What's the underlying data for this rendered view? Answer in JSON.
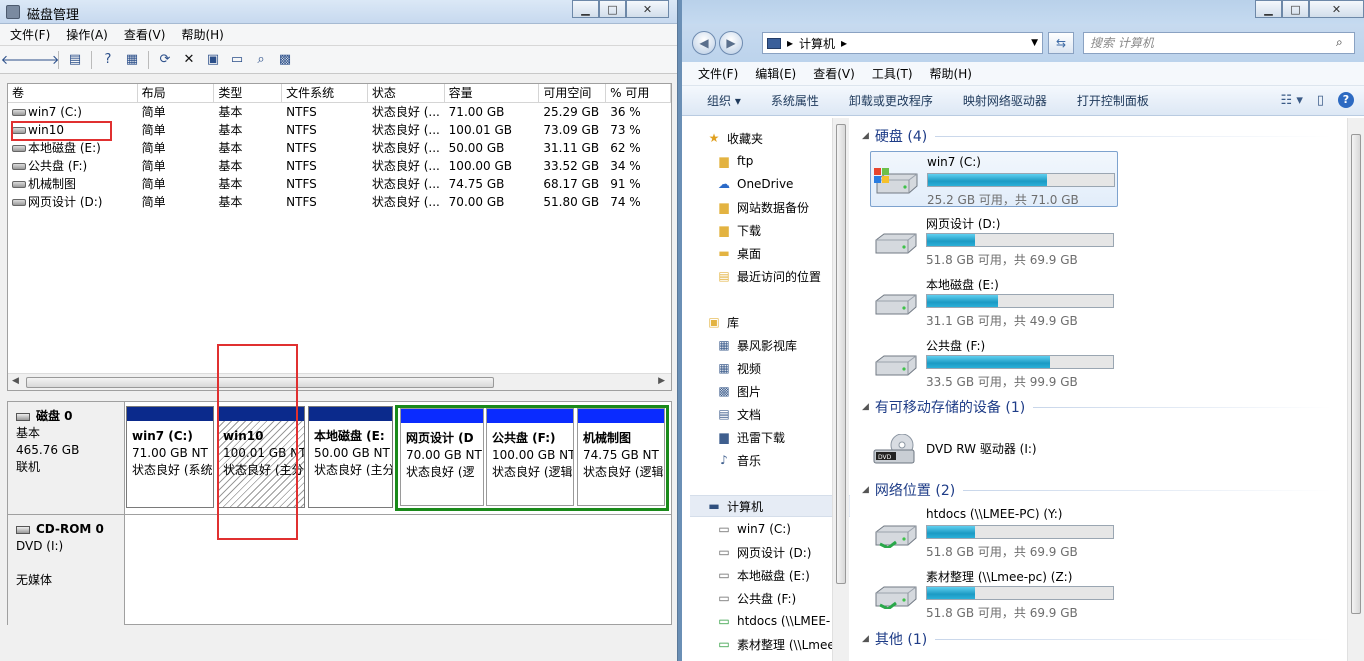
{
  "disk_mgmt": {
    "title": "磁盘管理",
    "menu": [
      "文件(F)",
      "操作(A)",
      "查看(V)",
      "帮助(H)"
    ],
    "columns": [
      "卷",
      "布局",
      "类型",
      "文件系统",
      "状态",
      "容量",
      "可用空间",
      "% 可用"
    ],
    "volumes": [
      [
        "win7 (C:)",
        "简单",
        "基本",
        "NTFS",
        "状态良好 (...",
        "71.00 GB",
        "25.29 GB",
        "36 %"
      ],
      [
        "win10",
        "简单",
        "基本",
        "NTFS",
        "状态良好 (...",
        "100.01 GB",
        "73.09 GB",
        "73 %"
      ],
      [
        "本地磁盘 (E:)",
        "简单",
        "基本",
        "NTFS",
        "状态良好 (...",
        "50.00 GB",
        "31.11 GB",
        "62 %"
      ],
      [
        "公共盘 (F:)",
        "简单",
        "基本",
        "NTFS",
        "状态良好 (...",
        "100.00 GB",
        "33.52 GB",
        "34 %"
      ],
      [
        "机械制图",
        "简单",
        "基本",
        "NTFS",
        "状态良好 (...",
        "74.75 GB",
        "68.17 GB",
        "91 %"
      ],
      [
        "网页设计 (D:)",
        "简单",
        "基本",
        "NTFS",
        "状态良好 (...",
        "70.00 GB",
        "51.80 GB",
        "74 %"
      ]
    ],
    "disk0": {
      "name": "磁盘 0",
      "type": "基本",
      "size": "465.76 GB",
      "status": "联机"
    },
    "partitions": [
      {
        "name": "win7  (C:)",
        "size": "71.00 GB NT",
        "status": "状态良好 (系统"
      },
      {
        "name": "win10",
        "size": "100.01 GB NT",
        "status": "状态良好 (主分"
      },
      {
        "name": "本地磁盘  (E:",
        "size": "50.00 GB NT",
        "status": "状态良好 (主分"
      },
      {
        "name": "网页设计  (D",
        "size": "70.00 GB NT",
        "status": "状态良好 (逻"
      },
      {
        "name": "公共盘  (F:)",
        "size": "100.00 GB NT",
        "status": "状态良好 (逻辑"
      },
      {
        "name": "机械制图",
        "size": "74.75 GB NT",
        "status": "状态良好 (逻辑"
      }
    ],
    "cdrom": {
      "name": "CD-ROM 0",
      "type": "DVD (I:)",
      "status": "无媒体"
    }
  },
  "explorer": {
    "address": [
      "计算机"
    ],
    "search_placeholder": "搜索 计算机",
    "menu": [
      "文件(F)",
      "编辑(E)",
      "查看(V)",
      "工具(T)",
      "帮助(H)"
    ],
    "commands": [
      "组织 ▾",
      "系统属性",
      "卸载或更改程序",
      "映射网络驱动器",
      "打开控制面板"
    ],
    "nav": {
      "favorites_label": "收藏夹",
      "favorites": [
        "ftp",
        "OneDrive",
        "网站数据备份",
        "下载",
        "桌面",
        "最近访问的位置"
      ],
      "libraries_label": "库",
      "libraries": [
        "暴风影视库",
        "视频",
        "图片",
        "文档",
        "迅雷下载",
        "音乐"
      ],
      "computer_label": "计算机",
      "computer": [
        "win7 (C:)",
        "网页设计 (D:)",
        "本地磁盘 (E:)",
        "公共盘 (F:)",
        "htdocs (\\\\LMEE-",
        "素材整理 (\\\\Lmee"
      ]
    },
    "groups": {
      "hdd": "硬盘 (4)",
      "removable": "有可移动存储的设备 (1)",
      "network": "网络位置 (2)",
      "other": "其他 (1)"
    },
    "drives": [
      {
        "name": "win7 (C:)",
        "info": "25.2 GB 可用，共 71.0 GB",
        "used_fraction": 0.64
      },
      {
        "name": "网页设计 (D:)",
        "info": "51.8 GB 可用，共 69.9 GB",
        "used_fraction": 0.26
      },
      {
        "name": "本地磁盘 (E:)",
        "info": "31.1 GB 可用，共 49.9 GB",
        "used_fraction": 0.38
      },
      {
        "name": "公共盘 (F:)",
        "info": "33.5 GB 可用，共 99.9 GB",
        "used_fraction": 0.66
      }
    ],
    "dvd": {
      "name": "DVD RW 驱动器 (I:)",
      "label": "DVD"
    },
    "net_drives": [
      {
        "name": "htdocs (\\\\LMEE-PC) (Y:)",
        "info": "51.8 GB 可用，共 69.9 GB",
        "used_fraction": 0.26
      },
      {
        "name": "素材整理 (\\\\Lmee-pc) (Z:)",
        "info": "51.8 GB 可用，共 69.9 GB",
        "used_fraction": 0.26
      }
    ]
  }
}
